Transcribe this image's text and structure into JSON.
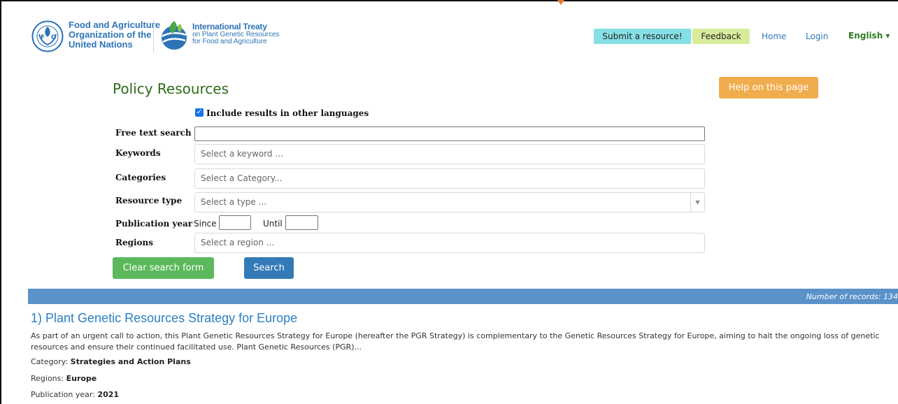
{
  "header": {
    "fao_logo_text": "Food and Agriculture\nOrganization of the\nUnited Nations",
    "treaty_title": "International Treaty",
    "treaty_subtitle": "on Plant Genetic Resources\nfor Food and Agriculture",
    "submit_label": "Submit a resource!",
    "feedback_label": "Feedback",
    "home_label": "Home",
    "login_label": "Login",
    "language_label": "English ▾"
  },
  "search": {
    "title": "Policy Resources",
    "help_label": "Help on this page",
    "include_other_languages_label": "Include results in other languages",
    "include_other_languages_checked": true,
    "free_text_label": "Free text search",
    "free_text_value": "",
    "keywords_label": "Keywords",
    "keywords_placeholder": "Select a keyword ...",
    "categories_label": "Categories",
    "categories_placeholder": "Select a Category...",
    "resource_type_label": "Resource type",
    "resource_type_placeholder": "Select a type ...",
    "publication_year_label": "Publication year",
    "since_label": "Since",
    "until_label": "Until",
    "regions_label": "Regions",
    "regions_placeholder": "Select a region ...",
    "clear_label": "Clear search form",
    "search_label": "Search"
  },
  "results": {
    "records_text": "Number of records: 134",
    "items": [
      {
        "title": "1) Plant Genetic Resources Strategy for Europe",
        "description": "As part of an urgent call to action, this Plant Genetic Resources Strategy for Europe (hereafter the PGR Strategy) is complementary to the Genetic Resources Strategy for Europe, aiming to halt the ongoing loss of genetic resources and ensure their continued facilitated use. Plant Genetic Resources (PGR)...",
        "category_label": "Category:",
        "category_value": "Strategies and Action Plans",
        "regions_label": "Regions:",
        "regions_value": "Europe",
        "year_label": "Publication year:",
        "year_value": "2021"
      }
    ]
  },
  "colors": {
    "submit_bg": "#86dfe5",
    "feedback_bg": "#d9ec9c",
    "help_bg": "#f0ad4e",
    "clear_bg": "#5cb85c",
    "search_bg": "#337ab7",
    "records_bar_bg": "#5b92c9",
    "title_green": "#2e6b1a",
    "link_blue": "#2a7fc1"
  }
}
